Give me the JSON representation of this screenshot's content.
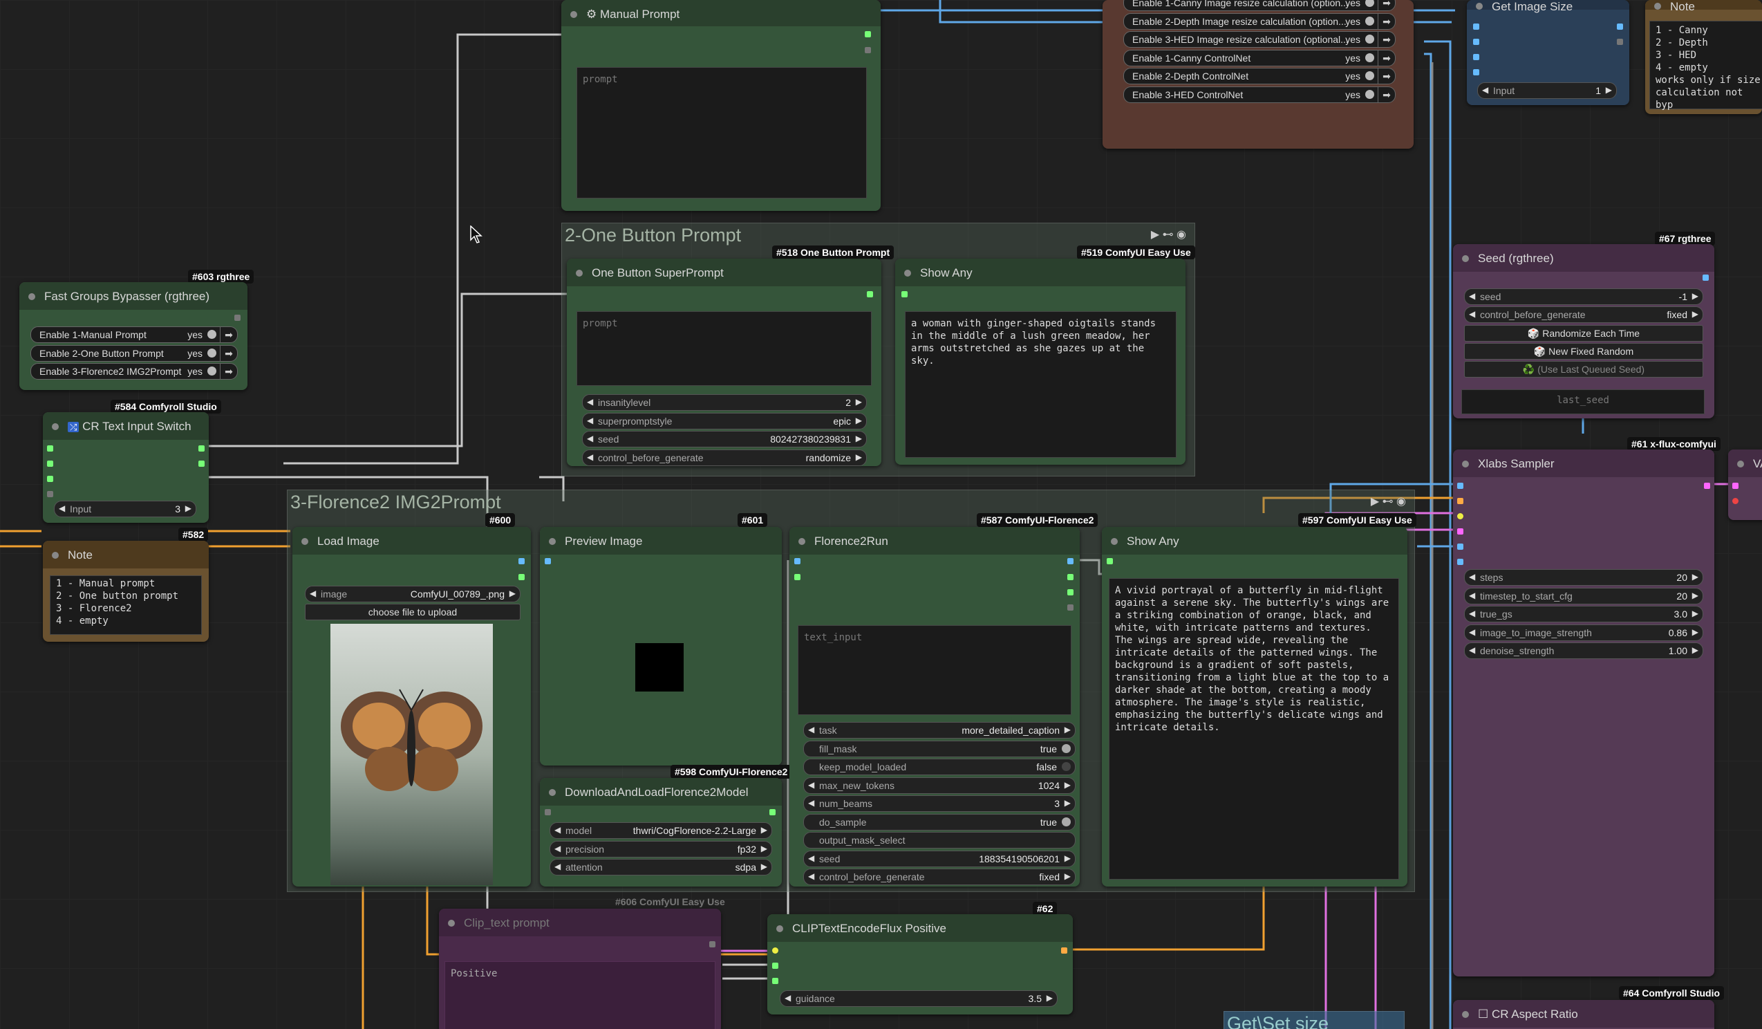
{
  "groups": {
    "one_button": {
      "title": "2-One Button Prompt"
    },
    "florence": {
      "title": "3-Florence2 IMG2Prompt"
    },
    "getset": {
      "title": "Get\\Set size"
    }
  },
  "manual_prompt": {
    "title": "Manual Prompt",
    "placeholder": "prompt"
  },
  "resize_enable": {
    "rows": [
      {
        "label": "Enable 1-Canny Image resize calculation (option...",
        "value": "yes"
      },
      {
        "label": "Enable 2-Depth Image resize calculation (option...",
        "value": "yes"
      },
      {
        "label": "Enable 3-HED Image resize calculation (optional...",
        "value": "yes"
      },
      {
        "label": "Enable 1-Canny ControlNet",
        "value": "yes"
      },
      {
        "label": "Enable 2-Depth ControlNet",
        "value": "yes"
      },
      {
        "label": "Enable 3-HED ControlNet",
        "value": "yes"
      }
    ]
  },
  "get_image_size": {
    "title": "Get Image Size",
    "input_label": "Input",
    "input_value": "1"
  },
  "note_top": {
    "title": "Note",
    "text": "1 - Canny\n2 - Depth\n3 - HED\n4 - empty\nworks only if size\ncalculation not byp"
  },
  "one_button_node": {
    "badge": "#518 One Button Prompt",
    "title": "One Button SuperPrompt",
    "placeholder": "prompt",
    "widgets": [
      {
        "label": "insanitylevel",
        "value": "2"
      },
      {
        "label": "superpromptstyle",
        "value": "epic"
      },
      {
        "label": "seed",
        "value": "802427380239831"
      },
      {
        "label": "control_before_generate",
        "value": "randomize"
      }
    ]
  },
  "show_any_519": {
    "badge": "#519 ComfyUI Easy Use",
    "title": "Show Any",
    "text": "a woman with ginger-shaped oigtails stands in the middle of a lush green meadow, her arms outstretched as she gazes up at the sky."
  },
  "fast_groups": {
    "badge": "#603 rgthree",
    "title": "Fast Groups Bypasser (rgthree)",
    "rows": [
      {
        "label": "Enable 1-Manual Prompt",
        "value": "yes"
      },
      {
        "label": "Enable 2-One Button Prompt",
        "value": "yes"
      },
      {
        "label": "Enable 3-Florence2 IMG2Prompt",
        "value": "yes"
      }
    ]
  },
  "cr_switch": {
    "badge": "#584 Comfyroll Studio",
    "title": "CR Text Input Switch",
    "input_label": "Input",
    "input_value": "3"
  },
  "note_left": {
    "badge": "#582",
    "title": "Note",
    "text": "1 - Manual prompt\n2 - One button prompt\n3 - Florence2\n4 - empty"
  },
  "load_image": {
    "badge": "#600",
    "title": "Load Image",
    "image_label": "image",
    "image_value": "ComfyUI_00789_.png",
    "upload_label": "choose file to upload"
  },
  "preview_image": {
    "badge": "#601",
    "title": "Preview Image"
  },
  "download_florence": {
    "badge": "#598 ComfyUI-Florence2",
    "title": "DownloadAndLoadFlorence2Model",
    "widgets": [
      {
        "label": "model",
        "value": "thwri/CogFlorence-2.2-Large"
      },
      {
        "label": "precision",
        "value": "fp32"
      },
      {
        "label": "attention",
        "value": "sdpa"
      }
    ]
  },
  "florence_run": {
    "badge": "#587 ComfyUI-Florence2",
    "title": "Florence2Run",
    "placeholder": "text_input",
    "widgets": [
      {
        "label": "task",
        "value": "more_detailed_caption",
        "kind": "combo"
      },
      {
        "label": "fill_mask",
        "value": "true",
        "kind": "toggle"
      },
      {
        "label": "keep_model_loaded",
        "value": "false",
        "kind": "toggle_off"
      },
      {
        "label": "max_new_tokens",
        "value": "1024",
        "kind": "combo"
      },
      {
        "label": "num_beams",
        "value": "3",
        "kind": "combo"
      },
      {
        "label": "do_sample",
        "value": "true",
        "kind": "toggle"
      },
      {
        "label": "output_mask_select",
        "value": "",
        "kind": "text"
      },
      {
        "label": "seed",
        "value": "188354190506201",
        "kind": "combo"
      },
      {
        "label": "control_before_generate",
        "value": "fixed",
        "kind": "combo"
      }
    ]
  },
  "show_any_597": {
    "badge": "#597 ComfyUI Easy Use",
    "title": "Show Any",
    "text": "A vivid portrayal of a butterfly in mid-flight against a serene sky. The butterfly's wings are a striking combination of orange, black, and white, with intricate patterns and textures. The wings are spread wide, revealing the intricate details of the patterned wings. The background is a gradient of soft pastels, transitioning from a light blue at the top to a darker shade at the bottom, creating a moody atmosphere. The image's style is realistic, emphasizing the butterfly's delicate wings and intricate details."
  },
  "seed_node": {
    "badge": "#67 rgthree",
    "title": "Seed (rgthree)",
    "seed_label": "seed",
    "seed_value": "-1",
    "cbg_label": "control_before_generate",
    "cbg_value": "fixed",
    "btn_randomize": "🎲 Randomize Each Time",
    "btn_fixed": "🎲 New Fixed Random",
    "btn_last": "♻️ (Use Last Queued Seed)",
    "last_seed_placeholder": "last_seed"
  },
  "xlabs": {
    "badge": "#61 x-flux-comfyui",
    "title": "Xlabs Sampler",
    "widgets": [
      {
        "label": "steps",
        "value": "20"
      },
      {
        "label": "timestep_to_start_cfg",
        "value": "20"
      },
      {
        "label": "true_gs",
        "value": "3.0"
      },
      {
        "label": "image_to_image_strength",
        "value": "0.86"
      },
      {
        "label": "denoise_strength",
        "value": "1.00"
      }
    ]
  },
  "va_partial": {
    "title": "VA"
  },
  "clip_text_prompt": {
    "badge": "#606 ComfyUI Easy Use",
    "title": "Clip_text prompt",
    "text": "Positive"
  },
  "clip_encode": {
    "badge": "#62",
    "title": "CLIPTextEncodeFlux Positive",
    "guidance_label": "guidance",
    "guidance_value": "3.5"
  },
  "cr_aspect": {
    "badge": "#64 Comfyroll Studio",
    "title": "CR Aspect Ratio"
  },
  "colors": {
    "wire_white": "#c8c8c8",
    "wire_orange": "#f0a030",
    "wire_blue": "#5fa8e8",
    "wire_pink": "#e070e0",
    "node_green": "#35553a",
    "node_purple": "#553a55"
  }
}
